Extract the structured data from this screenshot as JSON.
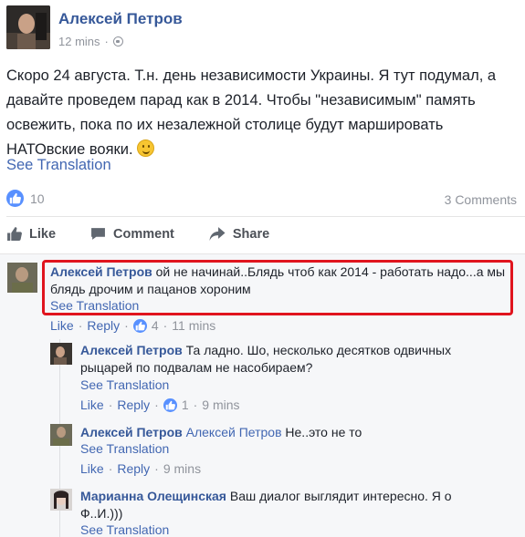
{
  "post": {
    "author": "Алексей Петров",
    "time": "12 mins",
    "separator": "·",
    "text": "Скоро 24 августа. Т.н. день независимости Украины. Я тут подумал, а давайте проведем парад как в 2014. Чтобы \"независимым\" память освежить, пока по их незалежной столице будут маршировать НАТОвские вояки.",
    "see_translation": "See Translation",
    "like_count": "10",
    "comments_count": "3 Comments",
    "icons": {
      "privacy": "globe-icon",
      "emoji": "smiley-emoji"
    }
  },
  "actions": {
    "like": "Like",
    "comment": "Comment",
    "share": "Share"
  },
  "comments": [
    {
      "author": "Алексей Петров",
      "text": "ой не начинай..Блядь чтоб как 2014 - работать надо...а мы блядь дрочим и пацанов хороним",
      "see_translation": "See Translation",
      "like": "Like",
      "reply": "Reply",
      "likes": "4",
      "time": "11 mins",
      "dot": "·",
      "highlight_color": "#e0141e"
    },
    {
      "author": "Алексей Петров",
      "text": "Та ладно. Шо, несколько десятков одвичных рыцарей по подвалам не насобираем?",
      "see_translation": "See Translation",
      "like": "Like",
      "reply": "Reply",
      "likes": "1",
      "time": "9 mins",
      "dot": "·"
    },
    {
      "author": "Алексей Петров",
      "mention": "Алексей Петров",
      "text": "Не..это не то",
      "see_translation": "See Translation",
      "like": "Like",
      "reply": "Reply",
      "time": "9 mins",
      "dot": "·"
    },
    {
      "author": "Марианна Олещинская",
      "text": "Ваш диалог выглядит интересно. Я о Ф..И.)))",
      "see_translation": "See Translation"
    }
  ],
  "colors": {
    "link": "#4267b2",
    "name": "#365899",
    "muted": "#90949c",
    "like_blue": "#5890ff"
  }
}
